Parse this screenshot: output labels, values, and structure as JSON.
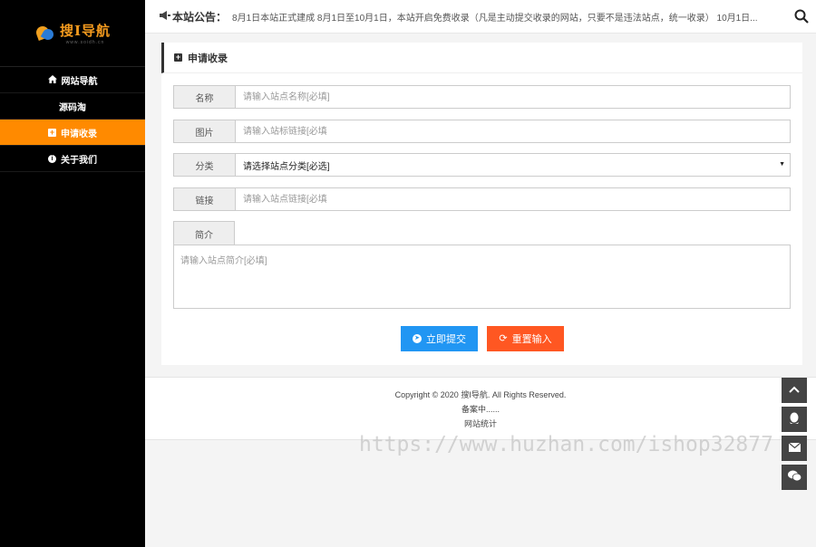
{
  "brand": {
    "title": "搜I导航",
    "subtitle": "www.soidh.cn"
  },
  "sidebar": {
    "items": [
      {
        "label": "网站导航",
        "icon": "home-icon"
      },
      {
        "label": "源码淘",
        "icon": ""
      },
      {
        "label": "申请收录",
        "icon": "plus-square-icon",
        "active": true
      },
      {
        "label": "关于我们",
        "icon": "info-circle-icon"
      }
    ]
  },
  "topbar": {
    "notice_label": "本站公告：",
    "notice_text": "8月1日本站正式建成 8月1日至10月1日，本站开启免费收录（凡是主动提交收录的网站，只要不是违法站点，统一收录） 10月1日..."
  },
  "panel": {
    "title": "申请收录",
    "fields": {
      "name": {
        "label": "名称",
        "placeholder": "请输入站点名称[必填]"
      },
      "image": {
        "label": "图片",
        "placeholder": "请输入站标链接[必填"
      },
      "category": {
        "label": "分类",
        "value": "请选择站点分类[必选]"
      },
      "link": {
        "label": "链接",
        "placeholder": "请输入站点链接[必填"
      },
      "intro": {
        "label": "简介",
        "placeholder": "请输入站点简介[必填]"
      }
    },
    "submit_label": "立即提交",
    "reset_label": "重置输入"
  },
  "footer": {
    "copyright": "Copyright © 2020 搜I导航. All Rights Reserved.",
    "icp": "备案中......",
    "stats": "网站统计"
  },
  "watermark": "https://www.huzhan.com/ishop32877",
  "colors": {
    "accent": "#ff8a00",
    "submit": "#2196f3",
    "reset": "#ff5722",
    "sidebar_bg": "#000000"
  }
}
